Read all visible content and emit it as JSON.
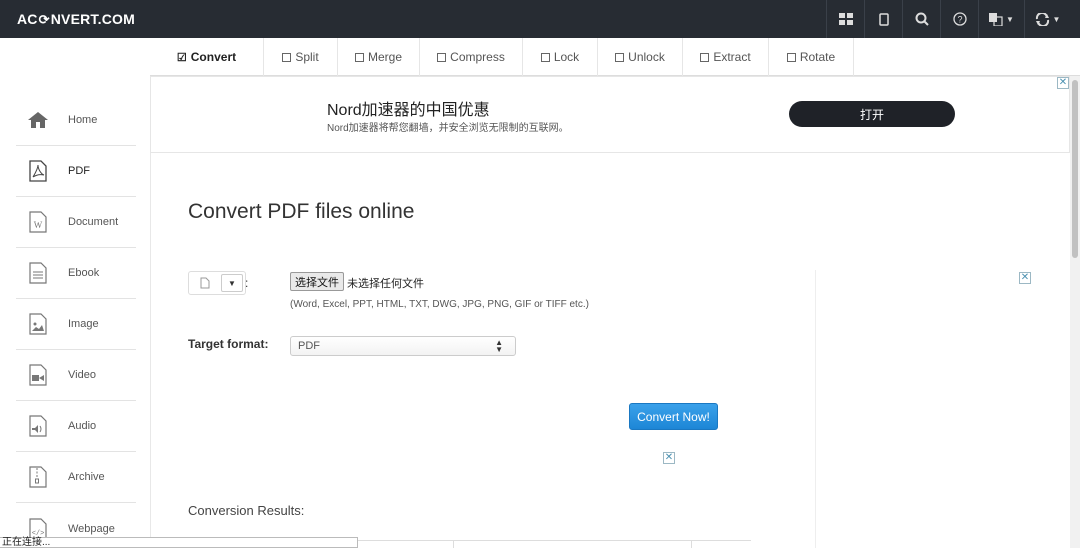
{
  "app": {
    "logo_left": "AC",
    "logo_right": "NVERT.COM"
  },
  "topbar_icons": [
    "grid-icon",
    "mobile-icon",
    "search-icon",
    "help-icon",
    "language-icon",
    "refresh-icon"
  ],
  "tabs": [
    {
      "label": "Convert",
      "active": true
    },
    {
      "label": "Split"
    },
    {
      "label": "Merge"
    },
    {
      "label": "Compress"
    },
    {
      "label": "Lock"
    },
    {
      "label": "Unlock"
    },
    {
      "label": "Extract"
    },
    {
      "label": "Rotate"
    }
  ],
  "sidebar": {
    "items": [
      {
        "label": "Home",
        "icon": "home-icon"
      },
      {
        "label": "PDF",
        "icon": "pdf-icon",
        "active": true
      },
      {
        "label": "Document",
        "icon": "word-document-icon"
      },
      {
        "label": "Ebook",
        "icon": "ebook-icon"
      },
      {
        "label": "Image",
        "icon": "image-icon"
      },
      {
        "label": "Video",
        "icon": "video-icon"
      },
      {
        "label": "Audio",
        "icon": "audio-icon"
      },
      {
        "label": "Archive",
        "icon": "archive-icon"
      },
      {
        "label": "Webpage",
        "icon": "webpage-icon"
      }
    ]
  },
  "ad": {
    "title": "Nord加速器的中国优惠",
    "subtitle": "Nord加速器将帮您翻墙，并安全浏览无限制的互联网。",
    "button": "打开"
  },
  "main": {
    "title": "Convert PDF files online",
    "choose_file": "选择文件",
    "no_file": "未选择任何文件",
    "formats": "(Word, Excel, PPT, HTML, TXT, DWG, JPG, PNG, GIF or TIFF etc.)",
    "colon": ":",
    "target_label": "Target format:",
    "target_value": "PDF",
    "convert_button": "Convert Now!",
    "results_label": "Conversion Results:"
  },
  "status_bar": "正在连接...",
  "colors": {
    "topbar": "#272c33",
    "convert_button": "#2a93e0",
    "ad_button": "#1f2228"
  }
}
